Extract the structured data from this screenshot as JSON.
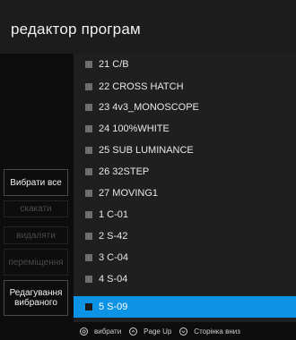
{
  "header": {
    "title": "редактор програм"
  },
  "sidebar": {
    "buttons": [
      {
        "label": "Вибрати все",
        "enabled": true
      },
      {
        "label": "скакати",
        "enabled": false
      },
      {
        "label": "видаляти",
        "enabled": false
      },
      {
        "label": "переміщення",
        "enabled": false
      },
      {
        "label": "Редагування вибраного",
        "enabled": true
      }
    ]
  },
  "programs": [
    {
      "label": "21 C/B"
    },
    {
      "label": "22 CROSS HATCH"
    },
    {
      "label": "23 4v3_MONOSCOPE"
    },
    {
      "label": "24 100%WHITE"
    },
    {
      "label": "25 SUB LUMINANCE"
    },
    {
      "label": "26 32STEP"
    },
    {
      "label": "27 MOVING1"
    },
    {
      "label": "1 C-01"
    },
    {
      "label": "2 S-42"
    },
    {
      "label": "3 C-04"
    },
    {
      "label": "4 S-04"
    },
    {
      "label": "5 S-09",
      "selected": true
    }
  ],
  "footer": {
    "hints": [
      {
        "icon": "ok-key-icon",
        "label": "вибрати"
      },
      {
        "icon": "page-up-key-icon",
        "label": "Page Up"
      },
      {
        "icon": "page-down-key-icon",
        "label": "Сторінка вниз"
      }
    ]
  },
  "colors": {
    "selection": "#0d93e5",
    "background": "#0d0d0d",
    "list_bg": "#1f1f1f"
  }
}
